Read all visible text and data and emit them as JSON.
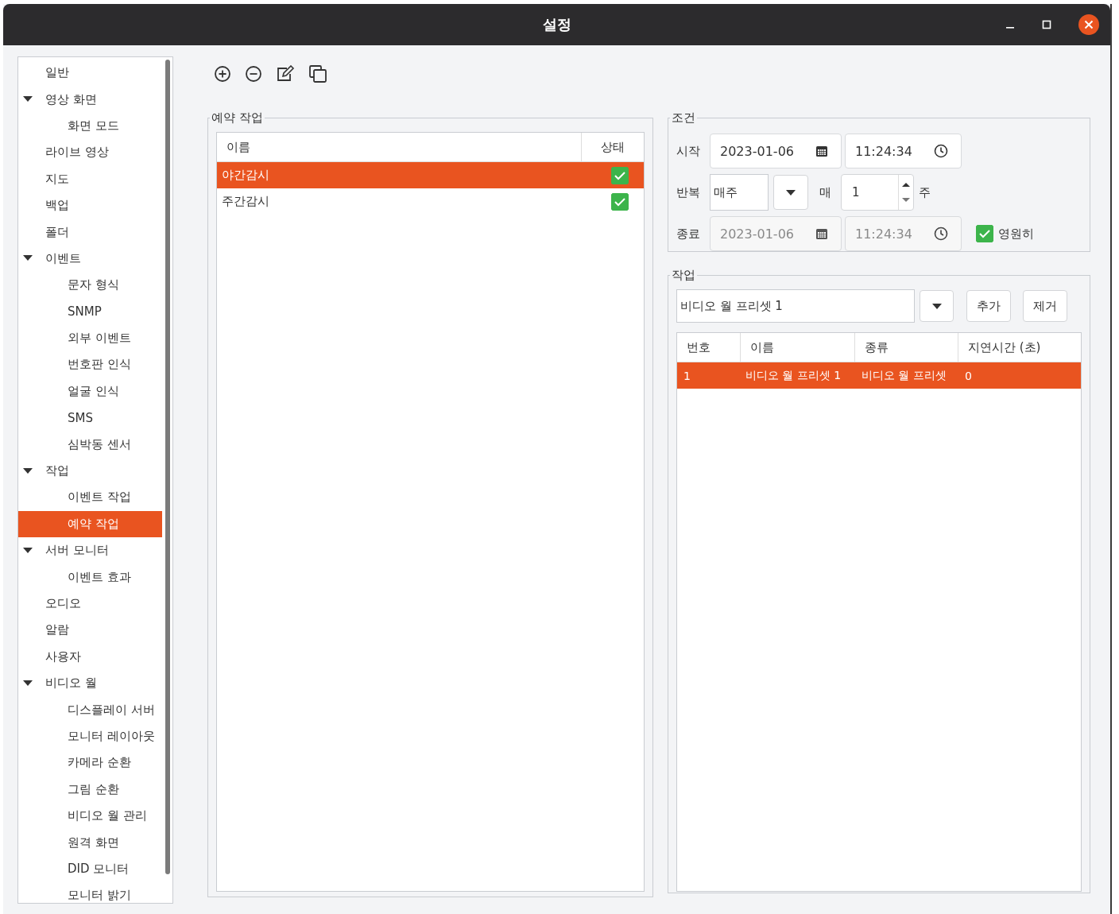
{
  "window": {
    "title": "설정"
  },
  "sidebar": {
    "items": [
      {
        "label": "일반",
        "selected": false
      },
      {
        "label": "영상 화면",
        "selected": false,
        "expanded": true,
        "children": [
          {
            "label": "화면 모드",
            "selected": false
          }
        ]
      },
      {
        "label": "라이브 영상",
        "selected": false
      },
      {
        "label": "지도",
        "selected": false
      },
      {
        "label": "백업",
        "selected": false
      },
      {
        "label": "폴더",
        "selected": false
      },
      {
        "label": "이벤트",
        "selected": false,
        "expanded": true,
        "children": [
          {
            "label": "문자 형식",
            "selected": false
          },
          {
            "label": "SNMP",
            "selected": false
          },
          {
            "label": "외부 이벤트",
            "selected": false
          },
          {
            "label": "번호판 인식",
            "selected": false
          },
          {
            "label": "얼굴 인식",
            "selected": false
          },
          {
            "label": "SMS",
            "selected": false
          },
          {
            "label": "심박동 센서",
            "selected": false
          }
        ]
      },
      {
        "label": "작업",
        "selected": false,
        "expanded": true,
        "children": [
          {
            "label": "이벤트 작업",
            "selected": false
          },
          {
            "label": "예약 작업",
            "selected": true
          }
        ]
      },
      {
        "label": "서버 모니터",
        "selected": false,
        "expanded": true,
        "children": [
          {
            "label": "이벤트 효과",
            "selected": false
          }
        ]
      },
      {
        "label": "오디오",
        "selected": false
      },
      {
        "label": "알람",
        "selected": false
      },
      {
        "label": "사용자",
        "selected": false
      },
      {
        "label": "비디오 월",
        "selected": false,
        "expanded": true,
        "children": [
          {
            "label": "디스플레이 서버",
            "selected": false
          },
          {
            "label": "모니터 레이아웃",
            "selected": false
          },
          {
            "label": "카메라 순환",
            "selected": false
          },
          {
            "label": "그림 순환",
            "selected": false
          },
          {
            "label": "비디오 월 관리",
            "selected": false
          },
          {
            "label": "원격 화면",
            "selected": false
          },
          {
            "label": "DID 모니터",
            "selected": false
          },
          {
            "label": "모니터 밝기",
            "selected": false
          }
        ]
      }
    ]
  },
  "schedule": {
    "title": "예약 작업",
    "columns": [
      "이름",
      "상태"
    ],
    "rows": [
      {
        "name": "야간감시",
        "checked": true,
        "selected": true
      },
      {
        "name": "주간감시",
        "checked": true,
        "selected": false
      }
    ]
  },
  "condition": {
    "title": "조건",
    "start": {
      "label": "시작",
      "date": "2023-01-06",
      "time": "11:24:34",
      "disabled": false
    },
    "repeat": {
      "label": "반복",
      "mode": "매주",
      "every_label": "매",
      "interval": "1",
      "unit": "주"
    },
    "end": {
      "label": "종료",
      "date": "2023-01-06",
      "time": "11:24:34",
      "disabled": true
    },
    "forever": {
      "label": "영원히",
      "checked": true
    }
  },
  "task": {
    "title": "작업",
    "preset": "비디오 월 프리셋 1",
    "buttons": [
      "추가",
      "제거"
    ],
    "columns": [
      "번호",
      "이름",
      "종류",
      "지연시간 (초)"
    ],
    "rows": [
      {
        "cells": [
          "1",
          "비디오 월 프리셋 1",
          "비디오 월 프리셋",
          "0"
        ],
        "selected": true
      }
    ]
  }
}
